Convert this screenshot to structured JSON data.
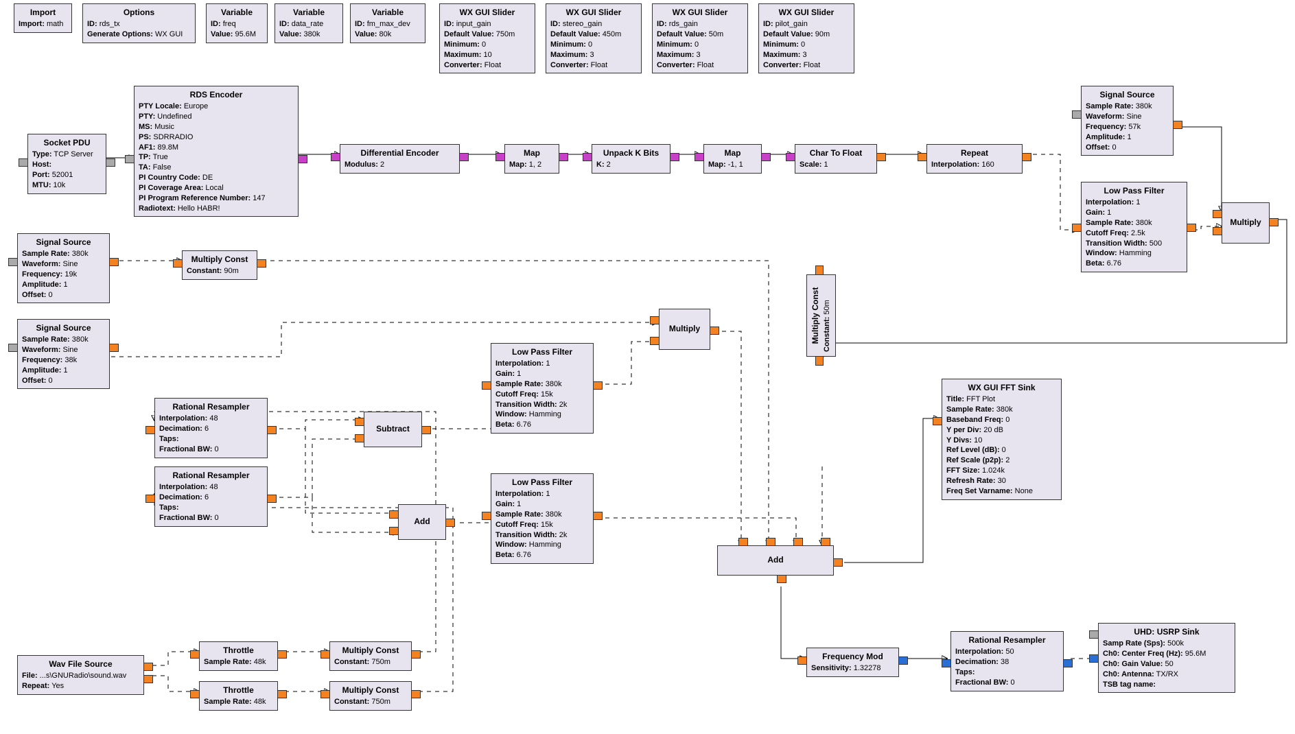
{
  "blocks": {
    "import": {
      "title": "Import",
      "params": [
        [
          "Import",
          "math"
        ]
      ]
    },
    "options": {
      "title": "Options",
      "params": [
        [
          "ID",
          "rds_tx"
        ],
        [
          "Generate Options",
          "WX GUI"
        ]
      ]
    },
    "var_freq": {
      "title": "Variable",
      "params": [
        [
          "ID",
          "freq"
        ],
        [
          "Value",
          "95.6M"
        ]
      ]
    },
    "var_rate": {
      "title": "Variable",
      "params": [
        [
          "ID",
          "data_rate"
        ],
        [
          "Value",
          "380k"
        ]
      ]
    },
    "var_dev": {
      "title": "Variable",
      "params": [
        [
          "ID",
          "fm_max_dev"
        ],
        [
          "Value",
          "80k"
        ]
      ]
    },
    "sld_in": {
      "title": "WX GUI Slider",
      "params": [
        [
          "ID",
          "input_gain"
        ],
        [
          "Default Value",
          "750m"
        ],
        [
          "Minimum",
          "0"
        ],
        [
          "Maximum",
          "10"
        ],
        [
          "Converter",
          "Float"
        ]
      ]
    },
    "sld_st": {
      "title": "WX GUI Slider",
      "params": [
        [
          "ID",
          "stereo_gain"
        ],
        [
          "Default Value",
          "450m"
        ],
        [
          "Minimum",
          "0"
        ],
        [
          "Maximum",
          "3"
        ],
        [
          "Converter",
          "Float"
        ]
      ]
    },
    "sld_rds": {
      "title": "WX GUI Slider",
      "params": [
        [
          "ID",
          "rds_gain"
        ],
        [
          "Default Value",
          "50m"
        ],
        [
          "Minimum",
          "0"
        ],
        [
          "Maximum",
          "3"
        ],
        [
          "Converter",
          "Float"
        ]
      ]
    },
    "sld_pil": {
      "title": "WX GUI Slider",
      "params": [
        [
          "ID",
          "pilot_gain"
        ],
        [
          "Default Value",
          "90m"
        ],
        [
          "Minimum",
          "0"
        ],
        [
          "Maximum",
          "3"
        ],
        [
          "Converter",
          "Float"
        ]
      ]
    },
    "socket": {
      "title": "Socket PDU",
      "params": [
        [
          "Type",
          "TCP Server"
        ],
        [
          "Host",
          ""
        ],
        [
          "Port",
          "52001"
        ],
        [
          "MTU",
          "10k"
        ]
      ]
    },
    "rds": {
      "title": "RDS Encoder",
      "params": [
        [
          "PTY Locale",
          "Europe"
        ],
        [
          "PTY",
          "Undefined"
        ],
        [
          "MS",
          "Music"
        ],
        [
          "PS",
          "SDRRADIO"
        ],
        [
          "AF1",
          "89.8M"
        ],
        [
          "TP",
          "True"
        ],
        [
          "TA",
          "False"
        ],
        [
          "PI Country Code",
          "DE"
        ],
        [
          "PI Coverage Area",
          "Local"
        ],
        [
          "PI Program Reference Number",
          "147"
        ],
        [
          "Radiotext",
          "Hello HABR!"
        ]
      ]
    },
    "diff": {
      "title": "Differential Encoder",
      "params": [
        [
          "Modulus",
          "2"
        ]
      ]
    },
    "map1": {
      "title": "Map",
      "params": [
        [
          "Map",
          "1, 2"
        ]
      ]
    },
    "unpack": {
      "title": "Unpack K Bits",
      "params": [
        [
          "K",
          "2"
        ]
      ]
    },
    "map2": {
      "title": "Map",
      "params": [
        [
          "Map",
          "-1, 1"
        ]
      ]
    },
    "c2f": {
      "title": "Char To Float",
      "params": [
        [
          "Scale",
          "1"
        ]
      ]
    },
    "repeat": {
      "title": "Repeat",
      "params": [
        [
          "Interpolation",
          "160"
        ]
      ]
    },
    "sig57": {
      "title": "Signal Source",
      "params": [
        [
          "Sample Rate",
          "380k"
        ],
        [
          "Waveform",
          "Sine"
        ],
        [
          "Frequency",
          "57k"
        ],
        [
          "Amplitude",
          "1"
        ],
        [
          "Offset",
          "0"
        ]
      ]
    },
    "lpf25": {
      "title": "Low Pass Filter",
      "params": [
        [
          "Interpolation",
          "1"
        ],
        [
          "Gain",
          "1"
        ],
        [
          "Sample Rate",
          "380k"
        ],
        [
          "Cutoff Freq",
          "2.5k"
        ],
        [
          "Transition Width",
          "500"
        ],
        [
          "Window",
          "Hamming"
        ],
        [
          "Beta",
          "6.76"
        ]
      ]
    },
    "mult_rds": {
      "title": "Multiply",
      "params": []
    },
    "sig19": {
      "title": "Signal Source",
      "params": [
        [
          "Sample Rate",
          "380k"
        ],
        [
          "Waveform",
          "Sine"
        ],
        [
          "Frequency",
          "19k"
        ],
        [
          "Amplitude",
          "1"
        ],
        [
          "Offset",
          "0"
        ]
      ]
    },
    "sig38": {
      "title": "Signal Source",
      "params": [
        [
          "Sample Rate",
          "380k"
        ],
        [
          "Waveform",
          "Sine"
        ],
        [
          "Frequency",
          "38k"
        ],
        [
          "Amplitude",
          "1"
        ],
        [
          "Offset",
          "0"
        ]
      ]
    },
    "mc_pilot": {
      "title": "Multiply Const",
      "params": [
        [
          "Constant",
          "90m"
        ]
      ]
    },
    "rr1": {
      "title": "Rational Resampler",
      "params": [
        [
          "Interpolation",
          "48"
        ],
        [
          "Decimation",
          "6"
        ],
        [
          "Taps",
          ""
        ],
        [
          "Fractional BW",
          "0"
        ]
      ]
    },
    "rr2": {
      "title": "Rational Resampler",
      "params": [
        [
          "Interpolation",
          "48"
        ],
        [
          "Decimation",
          "6"
        ],
        [
          "Taps",
          ""
        ],
        [
          "Fractional BW",
          "0"
        ]
      ]
    },
    "sub": {
      "title": "Subtract",
      "params": []
    },
    "add2": {
      "title": "Add",
      "params": []
    },
    "lpf_a": {
      "title": "Low Pass Filter",
      "params": [
        [
          "Interpolation",
          "1"
        ],
        [
          "Gain",
          "1"
        ],
        [
          "Sample Rate",
          "380k"
        ],
        [
          "Cutoff Freq",
          "15k"
        ],
        [
          "Transition Width",
          "2k"
        ],
        [
          "Window",
          "Hamming"
        ],
        [
          "Beta",
          "6.76"
        ]
      ]
    },
    "lpf_b": {
      "title": "Low Pass Filter",
      "params": [
        [
          "Interpolation",
          "1"
        ],
        [
          "Gain",
          "1"
        ],
        [
          "Sample Rate",
          "380k"
        ],
        [
          "Cutoff Freq",
          "15k"
        ],
        [
          "Transition Width",
          "2k"
        ],
        [
          "Window",
          "Hamming"
        ],
        [
          "Beta",
          "6.76"
        ]
      ]
    },
    "mult38": {
      "title": "Multiply",
      "params": []
    },
    "mc_rds": {
      "title": "Multiply Const",
      "params": [
        [
          "Constant",
          "50m"
        ]
      ],
      "rotated": true
    },
    "add_main": {
      "title": "Add",
      "params": []
    },
    "freqmod": {
      "title": "Frequency Mod",
      "params": [
        [
          "Sensitivity",
          "1.32278"
        ]
      ]
    },
    "rr3": {
      "title": "Rational Resampler",
      "params": [
        [
          "Interpolation",
          "50"
        ],
        [
          "Decimation",
          "38"
        ],
        [
          "Taps",
          ""
        ],
        [
          "Fractional BW",
          "0"
        ]
      ]
    },
    "fft": {
      "title": "WX GUI FFT Sink",
      "params": [
        [
          "Title",
          "FFT Plot"
        ],
        [
          "Sample Rate",
          "380k"
        ],
        [
          "Baseband Freq",
          "0"
        ],
        [
          "Y per Div",
          "20 dB"
        ],
        [
          "Y Divs",
          "10"
        ],
        [
          "Ref Level (dB)",
          "0"
        ],
        [
          "Ref Scale (p2p)",
          "2"
        ],
        [
          "FFT Size",
          "1.024k"
        ],
        [
          "Refresh Rate",
          "30"
        ],
        [
          "Freq Set Varname",
          "None"
        ]
      ]
    },
    "usrp": {
      "title": "UHD: USRP Sink",
      "params": [
        [
          "Samp Rate (Sps)",
          "500k"
        ],
        [
          "Ch0: Center Freq (Hz)",
          "95.6M"
        ],
        [
          "Ch0: Gain Value",
          "50"
        ],
        [
          "Ch0: Antenna",
          "TX/RX"
        ],
        [
          "TSB tag name",
          ""
        ]
      ]
    },
    "wav": {
      "title": "Wav File Source",
      "params": [
        [
          "File",
          "...s\\GNURadio\\sound.wav"
        ],
        [
          "Repeat",
          "Yes"
        ]
      ]
    },
    "th1": {
      "title": "Throttle",
      "params": [
        [
          "Sample Rate",
          "48k"
        ]
      ]
    },
    "th2": {
      "title": "Throttle",
      "params": [
        [
          "Sample Rate",
          "48k"
        ]
      ]
    },
    "mc_in1": {
      "title": "Multiply Const",
      "params": [
        [
          "Constant",
          "750m"
        ]
      ]
    },
    "mc_in2": {
      "title": "Multiply Const",
      "params": [
        [
          "Constant",
          "750m"
        ]
      ]
    }
  }
}
